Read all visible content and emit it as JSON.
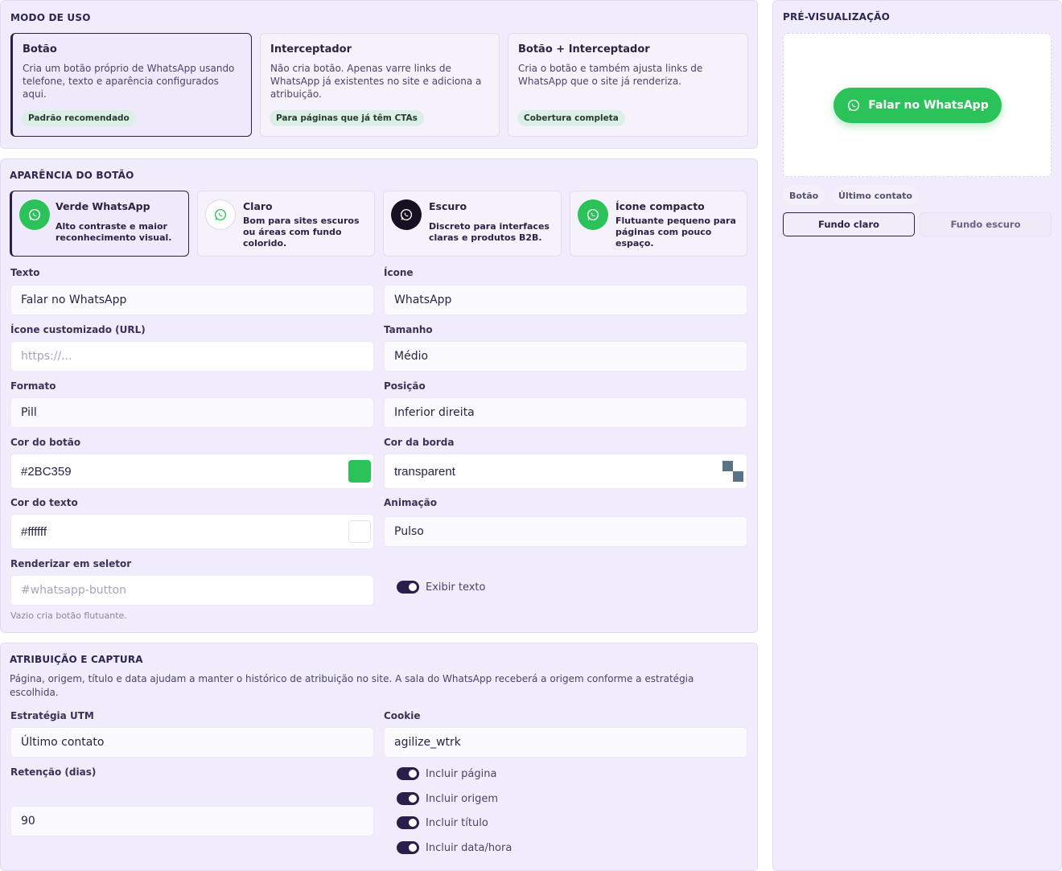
{
  "mode": {
    "title": "MODO DE USO",
    "cards": [
      {
        "title": "Botão",
        "desc": "Cria um botão próprio de WhatsApp usando telefone, texto e aparência configurados aqui.",
        "badge": "Padrão recomendado"
      },
      {
        "title": "Interceptador",
        "desc": "Não cria botão. Apenas varre links de WhatsApp já existentes no site e adiciona a atribuição.",
        "badge": "Para páginas que já têm CTAs"
      },
      {
        "title": "Botão + Interceptador",
        "desc": "Cria o botão e também ajusta links de WhatsApp que o site já renderiza.",
        "badge": "Cobertura completa"
      }
    ]
  },
  "appearance": {
    "title": "APARÊNCIA DO BOTÃO",
    "styles": [
      {
        "title": "Verde WhatsApp",
        "desc": "Alto contraste e maior reconhecimento visual.",
        "icon": "whatsapp-icon"
      },
      {
        "title": "Claro",
        "desc": "Bom para sites escuros ou áreas com fundo colorido.",
        "icon": "whatsapp-icon"
      },
      {
        "title": "Escuro",
        "desc": "Discreto para interfaces claras e produtos B2B.",
        "icon": "whatsapp-icon"
      },
      {
        "title": "Ícone compacto",
        "desc": "Flutuante pequeno para páginas com pouco espaço.",
        "icon": "whatsapp-icon"
      }
    ],
    "fields": {
      "text_label": "Texto",
      "text_value": "Falar no WhatsApp",
      "icon_label": "Ícone",
      "icon_value": "WhatsApp",
      "custom_icon_label": "Ícone customizado (URL)",
      "custom_icon_placeholder": "https://...",
      "size_label": "Tamanho",
      "size_value": "Médio",
      "format_label": "Formato",
      "format_value": "Pill",
      "position_label": "Posição",
      "position_value": "Inferior direita",
      "btn_color_label": "Cor do botão",
      "btn_color_value": "#2BC359",
      "border_color_label": "Cor da borda",
      "border_color_value": "transparent",
      "text_color_label": "Cor do texto",
      "text_color_value": "#ffffff",
      "animation_label": "Animação",
      "animation_value": "Pulso",
      "selector_label": "Renderizar em seletor",
      "selector_placeholder": "#whatsapp-button",
      "selector_hint": "Vazio cria botão flutuante.",
      "show_text_label": "Exibir texto"
    }
  },
  "attribution": {
    "title": "ATRIBUIÇÃO E CAPTURA",
    "desc": "Página, origem, título e data ajudam a manter o histórico de atribuição no site. A sala do WhatsApp receberá a origem conforme a estratégia escolhida.",
    "utm_label": "Estratégia UTM",
    "utm_value": "Último contato",
    "cookie_label": "Cookie",
    "cookie_value": "agilize_wtrk",
    "retention_label": "Retenção (dias)",
    "retention_value": "90",
    "toggles": [
      "Incluir página",
      "Incluir origem",
      "Incluir título",
      "Incluir data/hora"
    ]
  },
  "preview": {
    "title": "PRÉ-VISUALIZAÇÃO",
    "button_label": "Falar no WhatsApp",
    "chips": [
      "Botão",
      "Último contato"
    ],
    "bg_light": "Fundo claro",
    "bg_dark": "Fundo escuro"
  },
  "colors": {
    "whatsapp_green": "#2bc359",
    "dark": "#2a2148",
    "border_swatch": "#5a7384"
  }
}
